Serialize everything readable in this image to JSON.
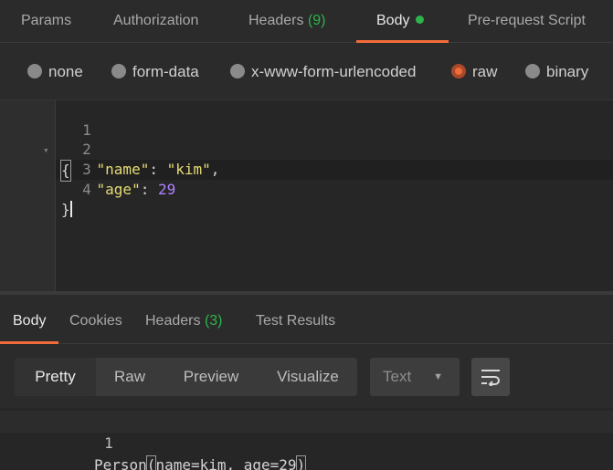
{
  "request_tabs": [
    {
      "label": "Params"
    },
    {
      "label": "Authorization"
    },
    {
      "label": "Headers",
      "count": "(9)"
    },
    {
      "label": "Body"
    },
    {
      "label": "Pre-request Script"
    }
  ],
  "body_types": [
    {
      "label": "none",
      "selected": false
    },
    {
      "label": "form-data",
      "selected": false
    },
    {
      "label": "x-www-form-urlencoded",
      "selected": false
    },
    {
      "label": "raw",
      "selected": true
    },
    {
      "label": "binary",
      "selected": false
    }
  ],
  "editor": {
    "line_numbers": [
      "1",
      "2",
      "3",
      "4"
    ],
    "line1": "{",
    "line2_key": "\"name\"",
    "line2_colon": ": ",
    "line2_value": "\"kim\"",
    "line2_comma": ",",
    "line3_key": "\"age\"",
    "line3_colon": ": ",
    "line3_value": "29",
    "line4": "}"
  },
  "response_tabs": [
    {
      "label": "Body"
    },
    {
      "label": "Cookies"
    },
    {
      "label": "Headers",
      "count": "(3)"
    },
    {
      "label": "Test Results"
    }
  ],
  "view_modes": [
    "Pretty",
    "Raw",
    "Preview",
    "Visualize"
  ],
  "format_select": {
    "value": "Text"
  },
  "response": {
    "line_number": "1",
    "pre": "Person",
    "open": "(",
    "mid": "name=kim, age=29",
    "close": ")"
  },
  "colors": {
    "accent": "#f26b3a",
    "green": "#2db34a",
    "background": "#2b2b2b"
  },
  "icons": [
    "fold-arrow-icon",
    "dropdown-arrow-icon",
    "wrap-lines-icon",
    "status-dot-icon"
  ]
}
